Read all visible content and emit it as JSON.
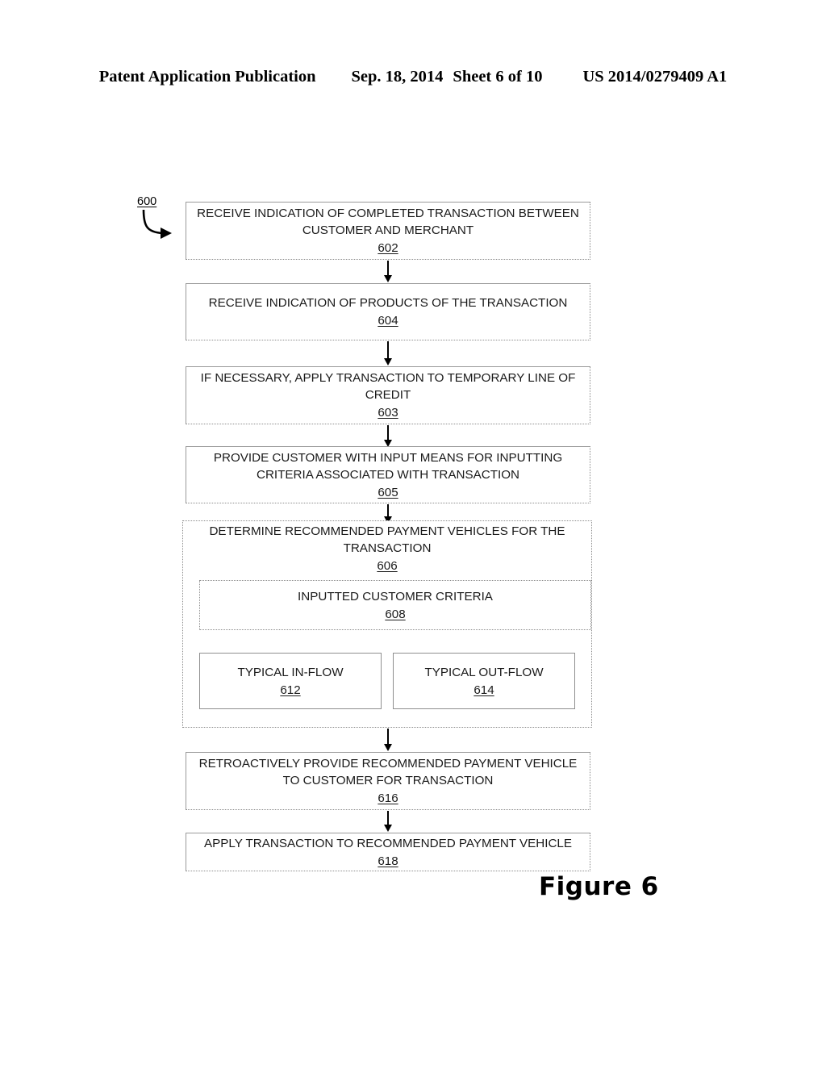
{
  "header": {
    "publication": "Patent Application Publication",
    "date": "Sep. 18, 2014",
    "sheet": "Sheet 6 of 10",
    "patent_number": "US 2014/0279409 A1"
  },
  "figure": {
    "caption": "Figure 6",
    "diagram_ref": "600"
  },
  "flowchart": {
    "steps": [
      {
        "text": "RECEIVE INDICATION OF COMPLETED TRANSACTION BETWEEN CUSTOMER AND MERCHANT",
        "number": "602"
      },
      {
        "text": "RECEIVE INDICATION OF PRODUCTS OF THE TRANSACTION",
        "number": "604"
      },
      {
        "text": "IF NECESSARY, APPLY TRANSACTION TO TEMPORARY LINE OF CREDIT",
        "number": "603"
      },
      {
        "text": "PROVIDE CUSTOMER WITH INPUT MEANS FOR INPUTTING CRITERIA ASSOCIATED WITH TRANSACTION",
        "number": "605"
      },
      {
        "text": "DETERMINE RECOMMENDED PAYMENT VEHICLES FOR THE TRANSACTION",
        "number": "606"
      },
      {
        "text": "RETROACTIVELY PROVIDE RECOMMENDED PAYMENT VEHICLE TO CUSTOMER FOR TRANSACTION",
        "number": "616"
      },
      {
        "text": "APPLY TRANSACTION TO RECOMMENDED PAYMENT VEHICLE",
        "number": "618"
      }
    ],
    "substeps": [
      {
        "text": "INPUTTED CUSTOMER CRITERIA",
        "number": "608"
      },
      {
        "text": "TYPICAL IN-FLOW",
        "number": "612"
      },
      {
        "text": "TYPICAL OUT-FLOW",
        "number": "614"
      }
    ]
  }
}
